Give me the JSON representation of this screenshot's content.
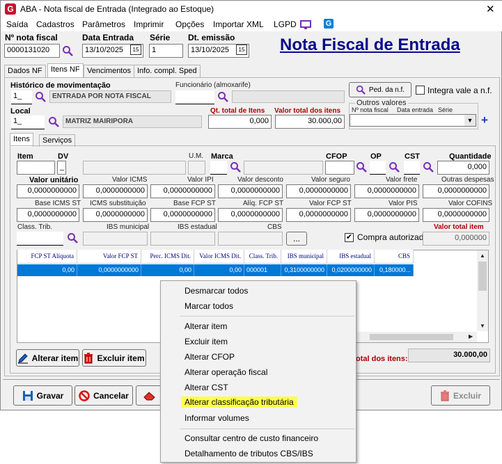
{
  "window": {
    "title": "ABA - Nota fiscal de Entrada (Integrado ao Estoque)",
    "close_glyph": "✕"
  },
  "menu": [
    "Saída",
    "Cadastros",
    "Parâmetros",
    "Imprimir",
    "Opções",
    "Importar XML",
    "LGPD"
  ],
  "header": {
    "nota_label": "Nº nota fiscal",
    "nota_value": "0000131020",
    "data_entrada_label": "Data Entrada",
    "data_entrada_value": "13/10/2025",
    "serie_label": "Série",
    "serie_value": "1",
    "emissao_label": "Dt. emissão",
    "emissao_value": "13/10/2025",
    "calendar_glyph": "15",
    "page_title": "Nota Fiscal de Entrada"
  },
  "main_tabs": [
    "Dados NF",
    "Itens NF",
    "Vencimentos",
    "Info. compl. Sped"
  ],
  "itens_nf": {
    "historico_label": "Histórico de movimentação",
    "historico_code": "1_",
    "historico_desc": "ENTRADA POR NOTA FISCAL",
    "funcionario_label": "Funcionário (almoxarife)",
    "ped_button": "Ped. da n.f.",
    "integra_label": "Integra vale a n.f.",
    "local_label": "Local",
    "local_code": "1_",
    "local_desc": "MATRIZ MAIRIPORA",
    "qt_total_label": "Qt. total de Itens",
    "qt_total_value": "0,000",
    "valor_total_label": "Valor total dos itens",
    "valor_total_value": "30.000,00",
    "outros_label": "Outros valores",
    "outros_col1": "Nº nota fiscal",
    "outros_col2": "Data entrada",
    "outros_col3": "Série",
    "plus_glyph": "+"
  },
  "sub_tabs": [
    "Itens",
    "Serviços"
  ],
  "item_fields": {
    "item_label": "Item",
    "dv_label": "DV",
    "dv_value": "_",
    "um_label": "U.M.",
    "marca_label": "Marca",
    "cfop_label": "CFOP",
    "op_label": "OP",
    "cst_label": "CST",
    "quantidade_label": "Quantidade",
    "quantidade_value": "0,000",
    "row1": [
      {
        "label": "Valor unitário",
        "value": "0,0000000000",
        "bold": true
      },
      {
        "label": "Valor ICMS",
        "value": "0,0000000000",
        "bold": false
      },
      {
        "label": "Valor IPI",
        "value": "0,0000000000",
        "bold": false
      },
      {
        "label": "Valor desconto",
        "value": "0,0000000000",
        "bold": false
      },
      {
        "label": "Valor seguro",
        "value": "0,0000000000",
        "bold": false
      },
      {
        "label": "Valor frete",
        "value": "0,0000000000",
        "bold": false
      },
      {
        "label": "Outras despesas",
        "value": "0,0000000000",
        "bold": false
      }
    ],
    "row2": [
      {
        "label": "Base ICMS ST",
        "value": "0,0000000000"
      },
      {
        "label": "ICMS substituição",
        "value": "0,0000000000"
      },
      {
        "label": "Base FCP ST",
        "value": "0,0000000000"
      },
      {
        "label": "Alíq. FCP ST",
        "value": "0,0000000000"
      },
      {
        "label": "Valor FCP ST",
        "value": "0,0000000000"
      },
      {
        "label": "Valor PIS",
        "value": "0,0000000000"
      },
      {
        "label": "Valor COFINS",
        "value": "0,0000000000"
      }
    ],
    "class_trib_label": "Class. Trib.",
    "ibs_mun_label": "IBS municipal",
    "ibs_est_label": "IBS estadual",
    "cbs_label": "CBS",
    "ellipsis": "...",
    "compra_autorizada_label": "Compra autorizada",
    "check_glyph": "✔",
    "valor_total_item_label": "Valor total item",
    "valor_total_item_value": "0,000000"
  },
  "grid": {
    "headers": [
      "FCP ST Alíquota",
      "Valor FCP ST",
      "Perc. ICMS Dit.",
      "Valor ICMS Dit.",
      "Class. Trib.",
      "IBS municipal",
      "IBS estadual",
      "CBS"
    ],
    "row": [
      "0,00",
      "0,0000000000",
      "0,00",
      "0,00",
      "000001",
      "0,3100000000",
      "0,0200000000",
      "0,180000..."
    ],
    "scroll_up": "▲",
    "scroll_down": "▼",
    "scroll_left": "◀",
    "scroll_right": "▶"
  },
  "bottom": {
    "alterar_item": "Alterar item",
    "excluir_item": "Excluir item",
    "total_itens_label": "otal dos itens:",
    "total_itens_value": "30.000,00"
  },
  "footer": {
    "gravar": "Gravar",
    "cancelar": "Cancelar",
    "excluir": "Excluir"
  },
  "context_menu": {
    "items": [
      "Desmarcar todos",
      "Marcar todos",
      "Alterar item",
      "Excluir item",
      "Alterar CFOP",
      "Alterar operação fiscal",
      "Alterar CST",
      "Alterar classificação tributária",
      "Informar volumes",
      "Consultar centro de custo financeiro",
      "Detalhamento de tributos CBS/IBS"
    ],
    "highlighted_index": 7
  },
  "colors": {
    "accent_blue": "#0078d7",
    "title_blue": "#0a0a8c",
    "label_red": "#b00000",
    "highlight": "#ffff4d",
    "icon_purple": "#7a2fb5"
  }
}
